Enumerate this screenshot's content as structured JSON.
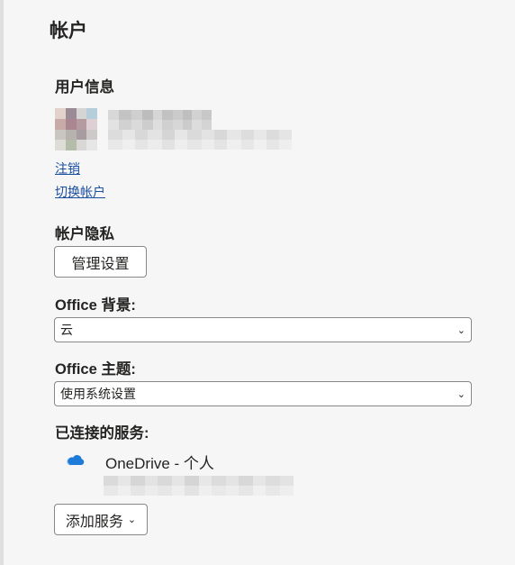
{
  "page": {
    "title": "帐户"
  },
  "user_info": {
    "heading": "用户信息",
    "sign_out_label": "注销",
    "switch_account_label": "切换帐户"
  },
  "privacy": {
    "heading": "帐户隐私",
    "manage_button_label": "管理设置"
  },
  "background": {
    "heading": "Office 背景:",
    "selected_value": "云"
  },
  "theme": {
    "heading": "Office 主题:",
    "selected_value": "使用系统设置"
  },
  "connected_services": {
    "heading": "已连接的服务:",
    "services": [
      {
        "name": "OneDrive - 个人",
        "icon": "onedrive-cloud-icon"
      }
    ],
    "add_button_label": "添加服务"
  },
  "colors": {
    "link": "#1a4fa0",
    "onedrive_blue": "#1f7bd8"
  }
}
